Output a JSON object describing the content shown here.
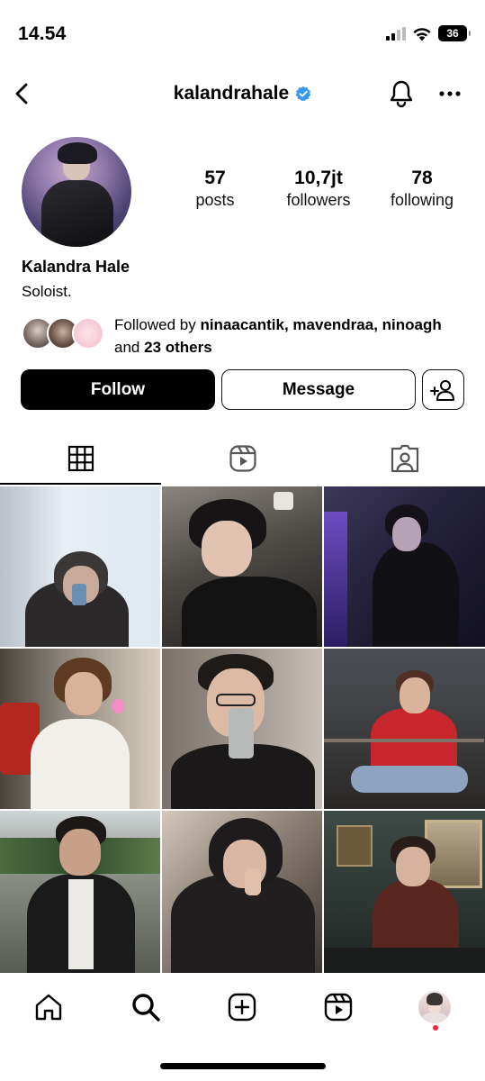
{
  "status_bar": {
    "time": "14.54",
    "battery": "36"
  },
  "header": {
    "username": "kalandrahale"
  },
  "profile": {
    "stats": [
      {
        "value": "57",
        "label": "posts"
      },
      {
        "value": "10,7jt",
        "label": "followers"
      },
      {
        "value": "78",
        "label": "following"
      }
    ],
    "display_name": "Kalandra Hale",
    "bio": "Soloist.",
    "followed_by": {
      "prefix": "Followed by",
      "names": "ninaacantik, mavendraa,",
      "name_last": "ninoagh",
      "connector": "and",
      "others": "23 others"
    }
  },
  "actions": {
    "follow_label": "Follow",
    "message_label": "Message"
  },
  "tabs": [
    {
      "icon": "grid-icon",
      "active": true
    },
    {
      "icon": "reels-icon",
      "active": false
    },
    {
      "icon": "tagged-icon",
      "active": false
    }
  ],
  "bottom_nav": [
    "home-icon",
    "search-icon",
    "create-icon",
    "reels-icon",
    "profile-avatar"
  ],
  "colors": {
    "verified": "#3897f0",
    "notification_dot": "#ff1f3d",
    "primary_button": "#000000"
  }
}
